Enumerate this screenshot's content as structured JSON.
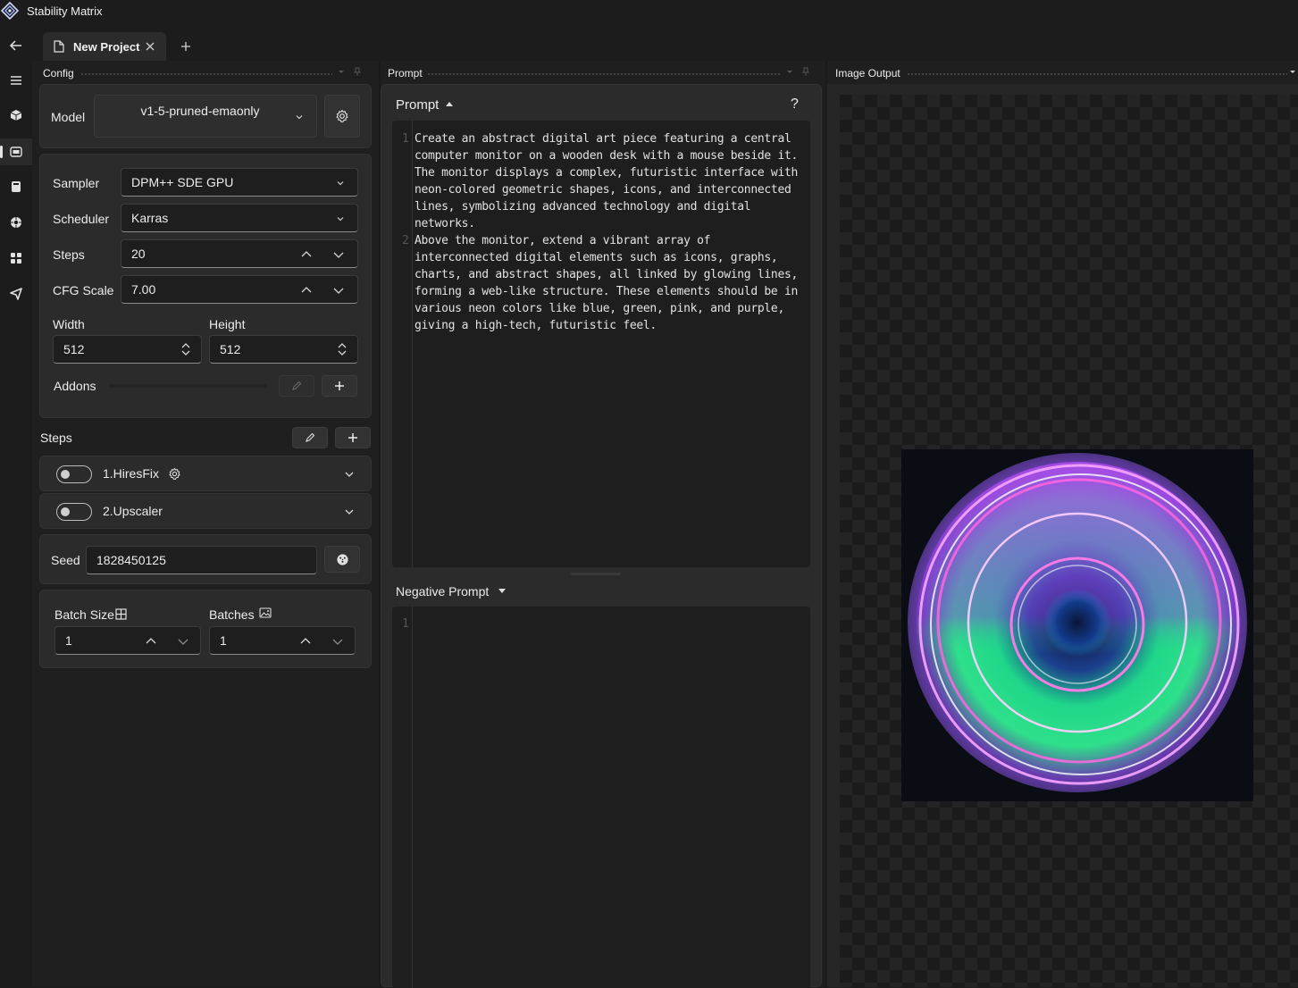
{
  "app": {
    "title": "Stability Matrix"
  },
  "tabs": {
    "items": [
      {
        "label": "New Project"
      }
    ]
  },
  "config": {
    "title": "Config",
    "model": {
      "label": "Model",
      "value": "v1-5-pruned-emaonly"
    },
    "sampler": {
      "label": "Sampler",
      "value": "DPM++ SDE GPU"
    },
    "scheduler": {
      "label": "Scheduler",
      "value": "Karras"
    },
    "steps": {
      "label": "Steps",
      "value": "20"
    },
    "cfg": {
      "label": "CFG Scale",
      "value": "7.00"
    },
    "width": {
      "label": "Width",
      "value": "512"
    },
    "height": {
      "label": "Height",
      "value": "512"
    },
    "addons": {
      "label": "Addons"
    },
    "steps_section": {
      "title": "Steps",
      "items": [
        {
          "label": "1.HiresFix"
        },
        {
          "label": "2.Upscaler"
        }
      ]
    },
    "seed": {
      "label": "Seed",
      "value": "1828450125"
    },
    "batch_size": {
      "label": "Batch Size",
      "value": "1"
    },
    "batches": {
      "label": "Batches",
      "value": "1"
    }
  },
  "prompt": {
    "panel_title": "Prompt",
    "title": "Prompt",
    "help": "?",
    "lines": [
      "Create an abstract digital art piece featuring a central computer monitor on a wooden desk with a mouse beside it. The monitor displays a complex, futuristic interface with neon-colored geometric shapes, icons, and interconnected lines, symbolizing advanced technology and digital networks.",
      "Above the monitor, extend a vibrant array of interconnected digital elements such as icons, graphs, charts, and abstract shapes, all linked by glowing lines, forming a web-like structure. These elements should be in various neon colors like blue, green, pink, and purple, giving a high-tech, futuristic feel."
    ],
    "line_numbers": [
      "1",
      "2"
    ],
    "negative_title": "Negative Prompt",
    "negative_line_numbers": [
      "1"
    ]
  },
  "output": {
    "title": "Image Output"
  },
  "colors": {
    "background": "#1c1c1c",
    "card": "#2b2b2b",
    "field": "#1e1e1e"
  }
}
